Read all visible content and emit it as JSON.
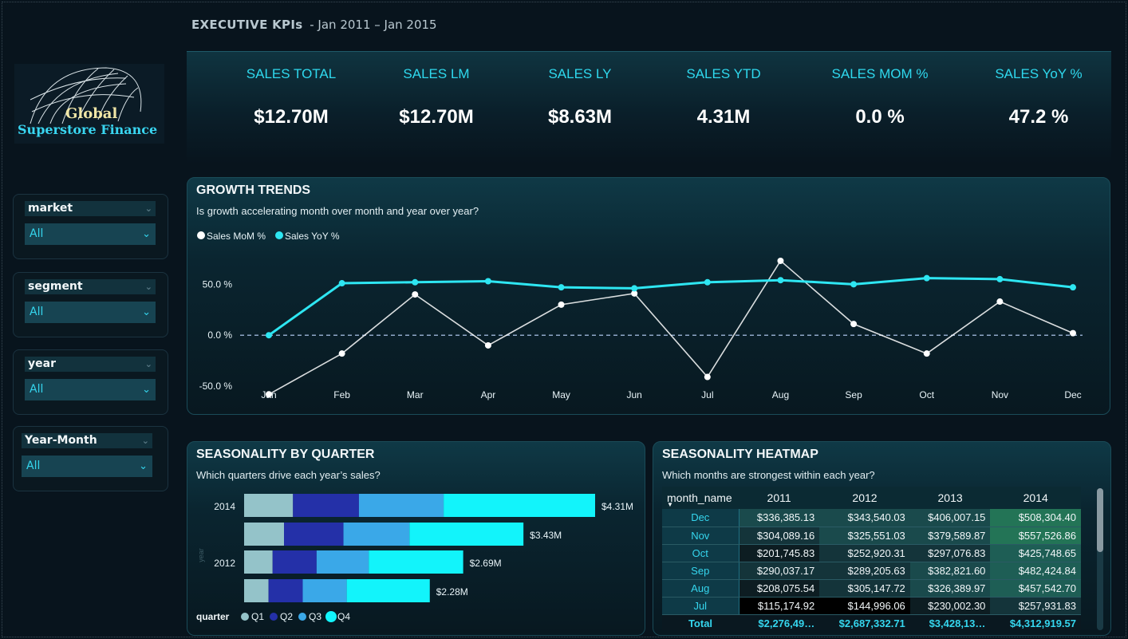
{
  "header": {
    "title": "EXECUTIVE KPIs",
    "range": "- Jan 2011 – Jan 2015"
  },
  "logo": {
    "line1": "Global",
    "line2": "Superstore Finance"
  },
  "kpis": [
    {
      "label": "SALES TOTAL",
      "value": "$12.70M"
    },
    {
      "label": "SALES LM",
      "value": "$12.70M"
    },
    {
      "label": "SALES LY",
      "value": "$8.63M"
    },
    {
      "label": "SALES YTD",
      "value": "4.31M"
    },
    {
      "label": "SALES MOM %",
      "value": "0.0 %"
    },
    {
      "label": "SALES YoY %",
      "value": "47.2 %"
    }
  ],
  "slicers": [
    {
      "title": "market",
      "value": "All"
    },
    {
      "title": "segment",
      "value": "All"
    },
    {
      "title": "year",
      "value": "All"
    },
    {
      "title": "Year-Month",
      "value": "All"
    }
  ],
  "growth": {
    "title": "GROWTH TRENDS",
    "subtitle": "Is growth accelerating month over month and year over year?",
    "legend": [
      "Sales MoM %",
      "Sales YoY %"
    ]
  },
  "quarter": {
    "title": "SEASONALITY BY QUARTER",
    "subtitle": "Which quarters drive each year’s sales?",
    "legend_title": "quarter",
    "axis_title": "year"
  },
  "heatmap": {
    "title": "SEASONALITY HEATMAP",
    "subtitle": "Which months are strongest within each year?",
    "row_header": "month_name",
    "columns": [
      "2011",
      "2012",
      "2013",
      "2014"
    ],
    "rows": [
      {
        "month": "Dec",
        "values": [
          "$336,385.13",
          "$343,540.03",
          "$406,007.15",
          "$508,304.40"
        ]
      },
      {
        "month": "Nov",
        "values": [
          "$304,089.16",
          "$325,551.03",
          "$379,589.87",
          "$557,526.86"
        ]
      },
      {
        "month": "Oct",
        "values": [
          "$201,745.83",
          "$252,920.31",
          "$297,076.83",
          "$425,748.65"
        ]
      },
      {
        "month": "Sep",
        "values": [
          "$290,037.17",
          "$289,205.63",
          "$382,821.60",
          "$482,424.84"
        ]
      },
      {
        "month": "Aug",
        "values": [
          "$208,075.54",
          "$305,147.72",
          "$326,389.97",
          "$457,542.70"
        ]
      },
      {
        "month": "Jul",
        "values": [
          "$115,174.92",
          "$144,996.06",
          "$230,002.30",
          "$257,931.83"
        ]
      }
    ],
    "total_label": "Total",
    "totals": [
      "$2,276,49…",
      "$2,687,332.71",
      "$3,428,13…",
      "$4,312,919.57"
    ]
  },
  "chart_data": [
    {
      "type": "line",
      "title": "GROWTH TRENDS",
      "categories": [
        "Jan",
        "Feb",
        "Mar",
        "Apr",
        "May",
        "Jun",
        "Jul",
        "Aug",
        "Sep",
        "Oct",
        "Nov",
        "Dec"
      ],
      "y_ticks": [
        "50.0 %",
        "0.0 %",
        "-50.0 %"
      ],
      "ylim": [
        -57,
        80
      ],
      "series": [
        {
          "name": "Sales MoM %",
          "color": "#ffffff",
          "values": [
            -58,
            -18,
            40,
            -10,
            30,
            41,
            -41,
            73,
            11,
            -18,
            33,
            2
          ]
        },
        {
          "name": "Sales YoY %",
          "color": "#2ee6f2",
          "values": [
            0,
            51,
            52,
            53,
            47,
            46,
            52,
            54,
            50,
            56,
            55,
            47
          ]
        }
      ],
      "reference_line": 0,
      "legend": "top-left"
    },
    {
      "type": "bar",
      "orientation": "horizontal",
      "stacked": true,
      "title": "SEASONALITY BY QUARTER",
      "categories": [
        "2014",
        "",
        "2012",
        ""
      ],
      "totals": [
        "$4.31M",
        "$3.43M",
        "$2.69M",
        "$2.28M"
      ],
      "series": [
        {
          "name": "Q1",
          "color": "#94c3c9",
          "values": [
            0.6,
            0.49,
            0.35,
            0.3
          ]
        },
        {
          "name": "Q2",
          "color": "#2430a8",
          "values": [
            0.81,
            0.73,
            0.54,
            0.42
          ]
        },
        {
          "name": "Q3",
          "color": "#3aa8e8",
          "values": [
            1.04,
            0.81,
            0.64,
            0.54
          ]
        },
        {
          "name": "Q4",
          "color": "#12f4fb",
          "values": [
            1.86,
            1.4,
            1.16,
            1.02
          ]
        }
      ],
      "legend": "bottom-left"
    }
  ]
}
